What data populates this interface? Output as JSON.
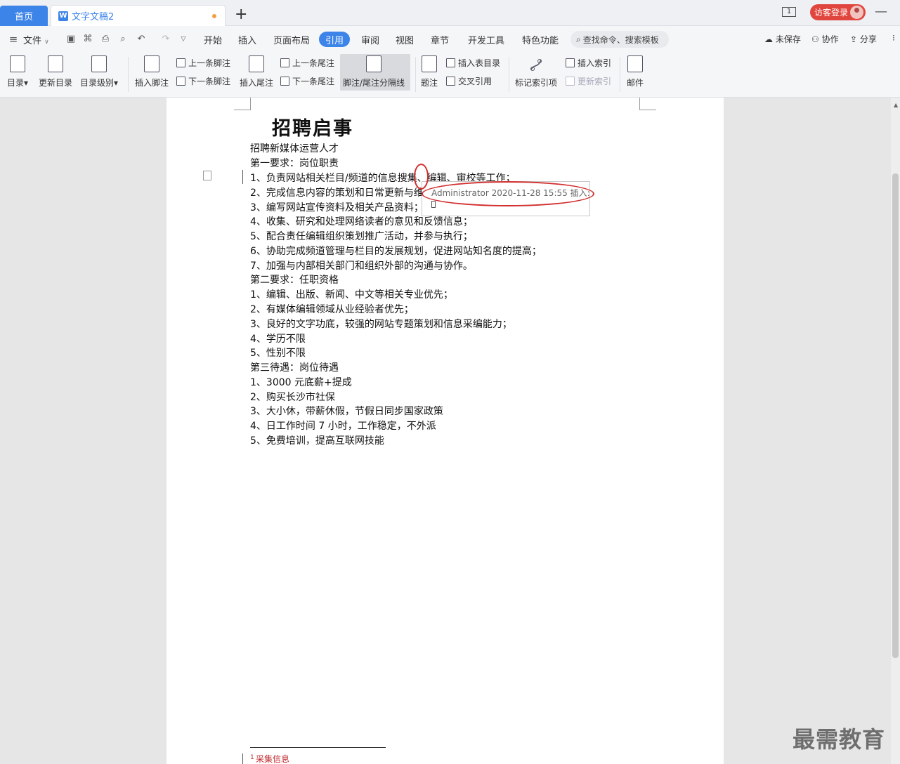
{
  "tabs": {
    "home": "首页",
    "doc_icon": "W",
    "doc": "文字文稿2",
    "new_tab": "+"
  },
  "header_right": {
    "page_count": "1",
    "login": "访客登录",
    "minimize": "—"
  },
  "menu": {
    "file": "文件",
    "items": [
      "开始",
      "插入",
      "页面布局",
      "引用",
      "审阅",
      "视图",
      "章节",
      "开发工具",
      "特色功能"
    ],
    "active": "引用",
    "search_placeholder": "查找命令、搜索模板",
    "unsaved": "未保存",
    "collaborate": "协作",
    "share": "分享"
  },
  "ribbon": {
    "toc": "目录",
    "update_toc": "更新目录",
    "toc_level": "目录级别",
    "insert_footnote": "插入脚注",
    "prev_footnote": "上一条脚注",
    "next_footnote": "下一条脚注",
    "insert_endnote": "插入尾注",
    "prev_endnote": "上一条尾注",
    "next_endnote": "下一条尾注",
    "separator": "脚注/尾注分隔线",
    "caption": "题注",
    "insert_table_toc": "插入表目录",
    "cross_ref": "交叉引用",
    "mark_index": "标记索引项",
    "insert_index": "插入索引",
    "update_index": "更新索引",
    "mail": "邮件"
  },
  "document": {
    "title": "招聘启事",
    "lines": [
      "招聘新媒体运营人才",
      "第一要求：岗位职责",
      "1、负责网站相关栏目/频道的信息搜集、编辑、审校等工作；",
      "2、完成信息内容的策划和日常更新与维护；",
      "3、编写网站宣传资料及相关产品资料；",
      "4、收集、研究和处理网络读者的意见和反馈信息；",
      "5、配合责任编辑组织策划推广活动，并参与执行；",
      "6、协助完成频道管理与栏目的发展规划，促进网站知名度的提高；",
      "7、加强与内部相关部门和组织外部的沟通与协作。",
      "第二要求：任职资格",
      "1、编辑、出版、新闻、中文等相关专业优先；",
      "2、有媒体编辑领域从业经验者优先；",
      "3、良好的文字功底，较强的网站专题策划和信息采编能力；",
      "4、学历不限",
      "5、性别不限",
      "第三待遇：岗位待遇",
      "1、3000 元底薪+提成",
      "2、购买长沙市社保",
      "3、大小休，带薪休假，节假日同步国家政策",
      "4、日工作时间 7 小时，工作稳定，不外派",
      "5、免费培训，提高互联网技能"
    ],
    "revision": "Administrator 2020-11-28 15:55 插入:",
    "footnote_mark": "1",
    "footnote": "采集信息"
  },
  "watermark": "最需教育",
  "colors": {
    "accent": "#3d84e8",
    "login": "#e0463d",
    "annotation": "#d23030"
  }
}
